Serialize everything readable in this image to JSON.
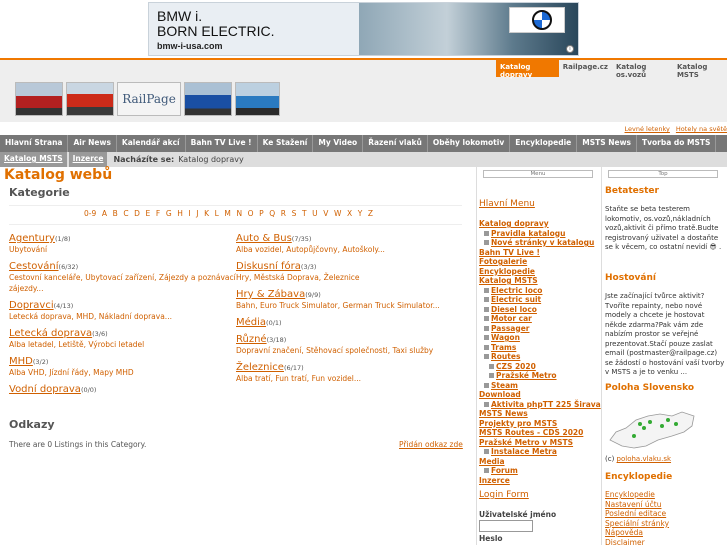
{
  "ad": {
    "text_line1": "BMW i.",
    "text_line2": "BORN ELECTRIC.",
    "url": "bmw-i-usa.com",
    "info": "i"
  },
  "top_nav": [
    "Katalog dopravy",
    "Railpage.cz",
    "Katalog os.vozů",
    "Katalog MSTS"
  ],
  "logo_text": "RailPage",
  "header_links": [
    "Levné letenky",
    "Hotely na světě"
  ],
  "main_nav": [
    "Hlavní Strana",
    "Air News",
    "Kalendář akcí",
    "Bahn TV Live !",
    "Ke Stažení",
    "My Video",
    "Řazení vlaků",
    "Oběhy lokomotiv",
    "Encyklopedie",
    "MSTS News",
    "Tvorba do MSTS"
  ],
  "sub_nav": {
    "tabs": [
      "Katalog MSTS",
      "Inzerce"
    ],
    "you_are_label": "Nacházíte se:",
    "you_are_value": "Katalog dopravy"
  },
  "main": {
    "title": "Katalog webů",
    "categories_heading": "Kategorie",
    "alphabet": [
      "0-9",
      "A",
      "B",
      "C",
      "D",
      "E",
      "F",
      "G",
      "H",
      "I",
      "J",
      "K",
      "L",
      "M",
      "N",
      "O",
      "P",
      "Q",
      "R",
      "S",
      "T",
      "U",
      "V",
      "W",
      "X",
      "Y",
      "Z"
    ],
    "categories_left": [
      {
        "name": "Agentury",
        "count": "(1/8)",
        "subs": "Ubytování"
      },
      {
        "name": "Cestování",
        "count": "(6/32)",
        "subs": "Cestovní kanceláře, Ubytovací zařízení, Zájezdy a poznávací zájezdy..."
      },
      {
        "name": "Dopravci",
        "count": "(4/13)",
        "subs": "Letecká doprava, MHD, Nákladní doprava..."
      },
      {
        "name": "Letecká doprava",
        "count": "(3/6)",
        "subs": "Alba letadel, Letiště, Výrobci letadel"
      },
      {
        "name": "MHD",
        "count": "(3/2)",
        "subs": "Alba VHD, Jízdní řády, Mapy MHD"
      },
      {
        "name": "Vodní doprava",
        "count": "(0/0)",
        "subs": ""
      }
    ],
    "categories_right": [
      {
        "name": "Auto & Bus",
        "count": "(7/35)",
        "subs": "Alba vozidel, Autopůjčovny, Autoškoly..."
      },
      {
        "name": "Diskusní fóra",
        "count": "(3/3)",
        "subs": "Hry, Městská Doprava, Železnice"
      },
      {
        "name": "Hry & Zábava",
        "count": "(9/9)",
        "subs": "Bahn, Euro Truck Simulator, German Truck Simulator..."
      },
      {
        "name": "Média",
        "count": "(0/1)",
        "subs": ""
      },
      {
        "name": "Různé",
        "count": "(3/18)",
        "subs": "Dopravní značení, Stěhovací společnosti, Taxi služby"
      },
      {
        "name": "Železnice",
        "count": "(6/17)",
        "subs": "Alba tratí, Fun tratí, Fun vozidel..."
      }
    ],
    "links_heading": "Odkazy",
    "listings_text": "There are 0 Listings in this Category.",
    "add_link": "Přidán odkaz zde"
  },
  "left_sidebar": {
    "box_tab": "Menu",
    "heading": "Hlavní Menu",
    "items": [
      {
        "label": "Katalog dopravy",
        "level": 0
      },
      {
        "label": "Pravidla katalogu",
        "level": 1
      },
      {
        "label": "Nové stránky v katalogu",
        "level": 1
      },
      {
        "label": "Bahn TV Live !",
        "level": 0
      },
      {
        "label": "Fotogalerie",
        "level": 0
      },
      {
        "label": "Encyklopedie",
        "level": 0
      },
      {
        "label": "Katalog MSTS",
        "level": 0
      },
      {
        "label": "Electric loco",
        "level": 1
      },
      {
        "label": "Electric suit",
        "level": 1
      },
      {
        "label": "Diesel loco",
        "level": 1
      },
      {
        "label": "Motor car",
        "level": 1
      },
      {
        "label": "Passager",
        "level": 1
      },
      {
        "label": "Wagon",
        "level": 1
      },
      {
        "label": "Trams",
        "level": 1
      },
      {
        "label": "Routes",
        "level": 1
      },
      {
        "label": "CZS 2020",
        "level": 2
      },
      {
        "label": "Pražské Metro",
        "level": 2
      },
      {
        "label": "Steam",
        "level": 1
      },
      {
        "label": "Download",
        "level": 0
      },
      {
        "label": "Aktivita phpTT 225 Širava",
        "level": 1
      },
      {
        "label": "MSTS News",
        "level": 0
      },
      {
        "label": "Projekty pro MSTS",
        "level": 0
      },
      {
        "label": "MSTS Routes - CDS 2020",
        "level": 0
      },
      {
        "label": "Pražské Metro v MSTS",
        "level": 0
      },
      {
        "label": "Instalace Metra",
        "level": 1
      },
      {
        "label": "Media",
        "level": 0
      },
      {
        "label": "Forum",
        "level": 1
      },
      {
        "label": "Inzerce",
        "level": 0
      }
    ],
    "login_heading": "Login Form",
    "username_label": "Uživatelské jméno",
    "password_label": "Heslo"
  },
  "right_sidebar": {
    "box_tab": "Top",
    "betatester_heading": "Betatester",
    "betatester_text": "Staňte se beta testerem lokomotiv, os.vozů,nákladních vozů,aktivit či přímo tratě.Budte registrovaný uživatel a dostaňte se k věcem, co ostatní nevidí 😎 .",
    "hosting_heading": "Hostování",
    "hosting_text": "Jste začínající tvůrce aktivit? Tvoříte repainty, nebo nové modely a chcete je hostovat někde zdarma?Pak vám zde nabízím prostor se veřejné prezentovat.Stačí pouze zaslat email (postmaster@railpage.cz) se žádostí o hostování vaší tvorby v MSTS a je to venku ...",
    "poloha_heading": "Poloha Slovensko",
    "poloha_credit_prefix": "(c)",
    "poloha_credit_link": "poloha.vlaku.sk",
    "encyklopedie_heading": "Encyklopedie",
    "encyklopedie_links": [
      "Encyklopedie",
      "Nastavení účtu",
      "Poslední editace",
      "Speciální stránky",
      "Nápověda",
      "Disclaimer"
    ]
  }
}
